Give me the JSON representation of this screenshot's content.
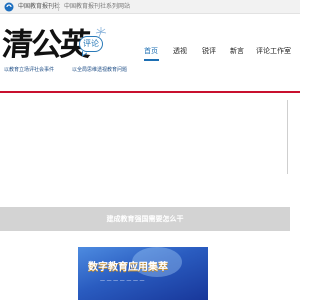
{
  "topbar": {
    "org_name": "中国教育报刊社",
    "site_group": "中国教育报刊社系列网站",
    "logo_icon": "cn-edu-logo-icon"
  },
  "logo": {
    "calligraphy": "清公英",
    "bubble_text": "评论",
    "decoration_icon": "dandelion-icon",
    "slogan_left": "以教育立场评社会事件",
    "slogan_right": "以全局思维透视教育问题"
  },
  "nav": {
    "items": [
      {
        "label": "首页",
        "active": true
      },
      {
        "label": "透视",
        "active": false
      },
      {
        "label": "锐评",
        "active": false
      },
      {
        "label": "新言",
        "active": false
      },
      {
        "label": "评论工作室",
        "active": false
      }
    ]
  },
  "banner": {
    "caption": "建成教育强国需要怎么干"
  },
  "thumbnail": {
    "title": "数字教育应用集萃",
    "subtitle": "— — — — — — —"
  },
  "colors": {
    "accent_red": "#c8102e",
    "nav_active": "#1d6fb3",
    "logo_blue": "#2a7ab8",
    "banner_gray": "#d3d3d3"
  }
}
